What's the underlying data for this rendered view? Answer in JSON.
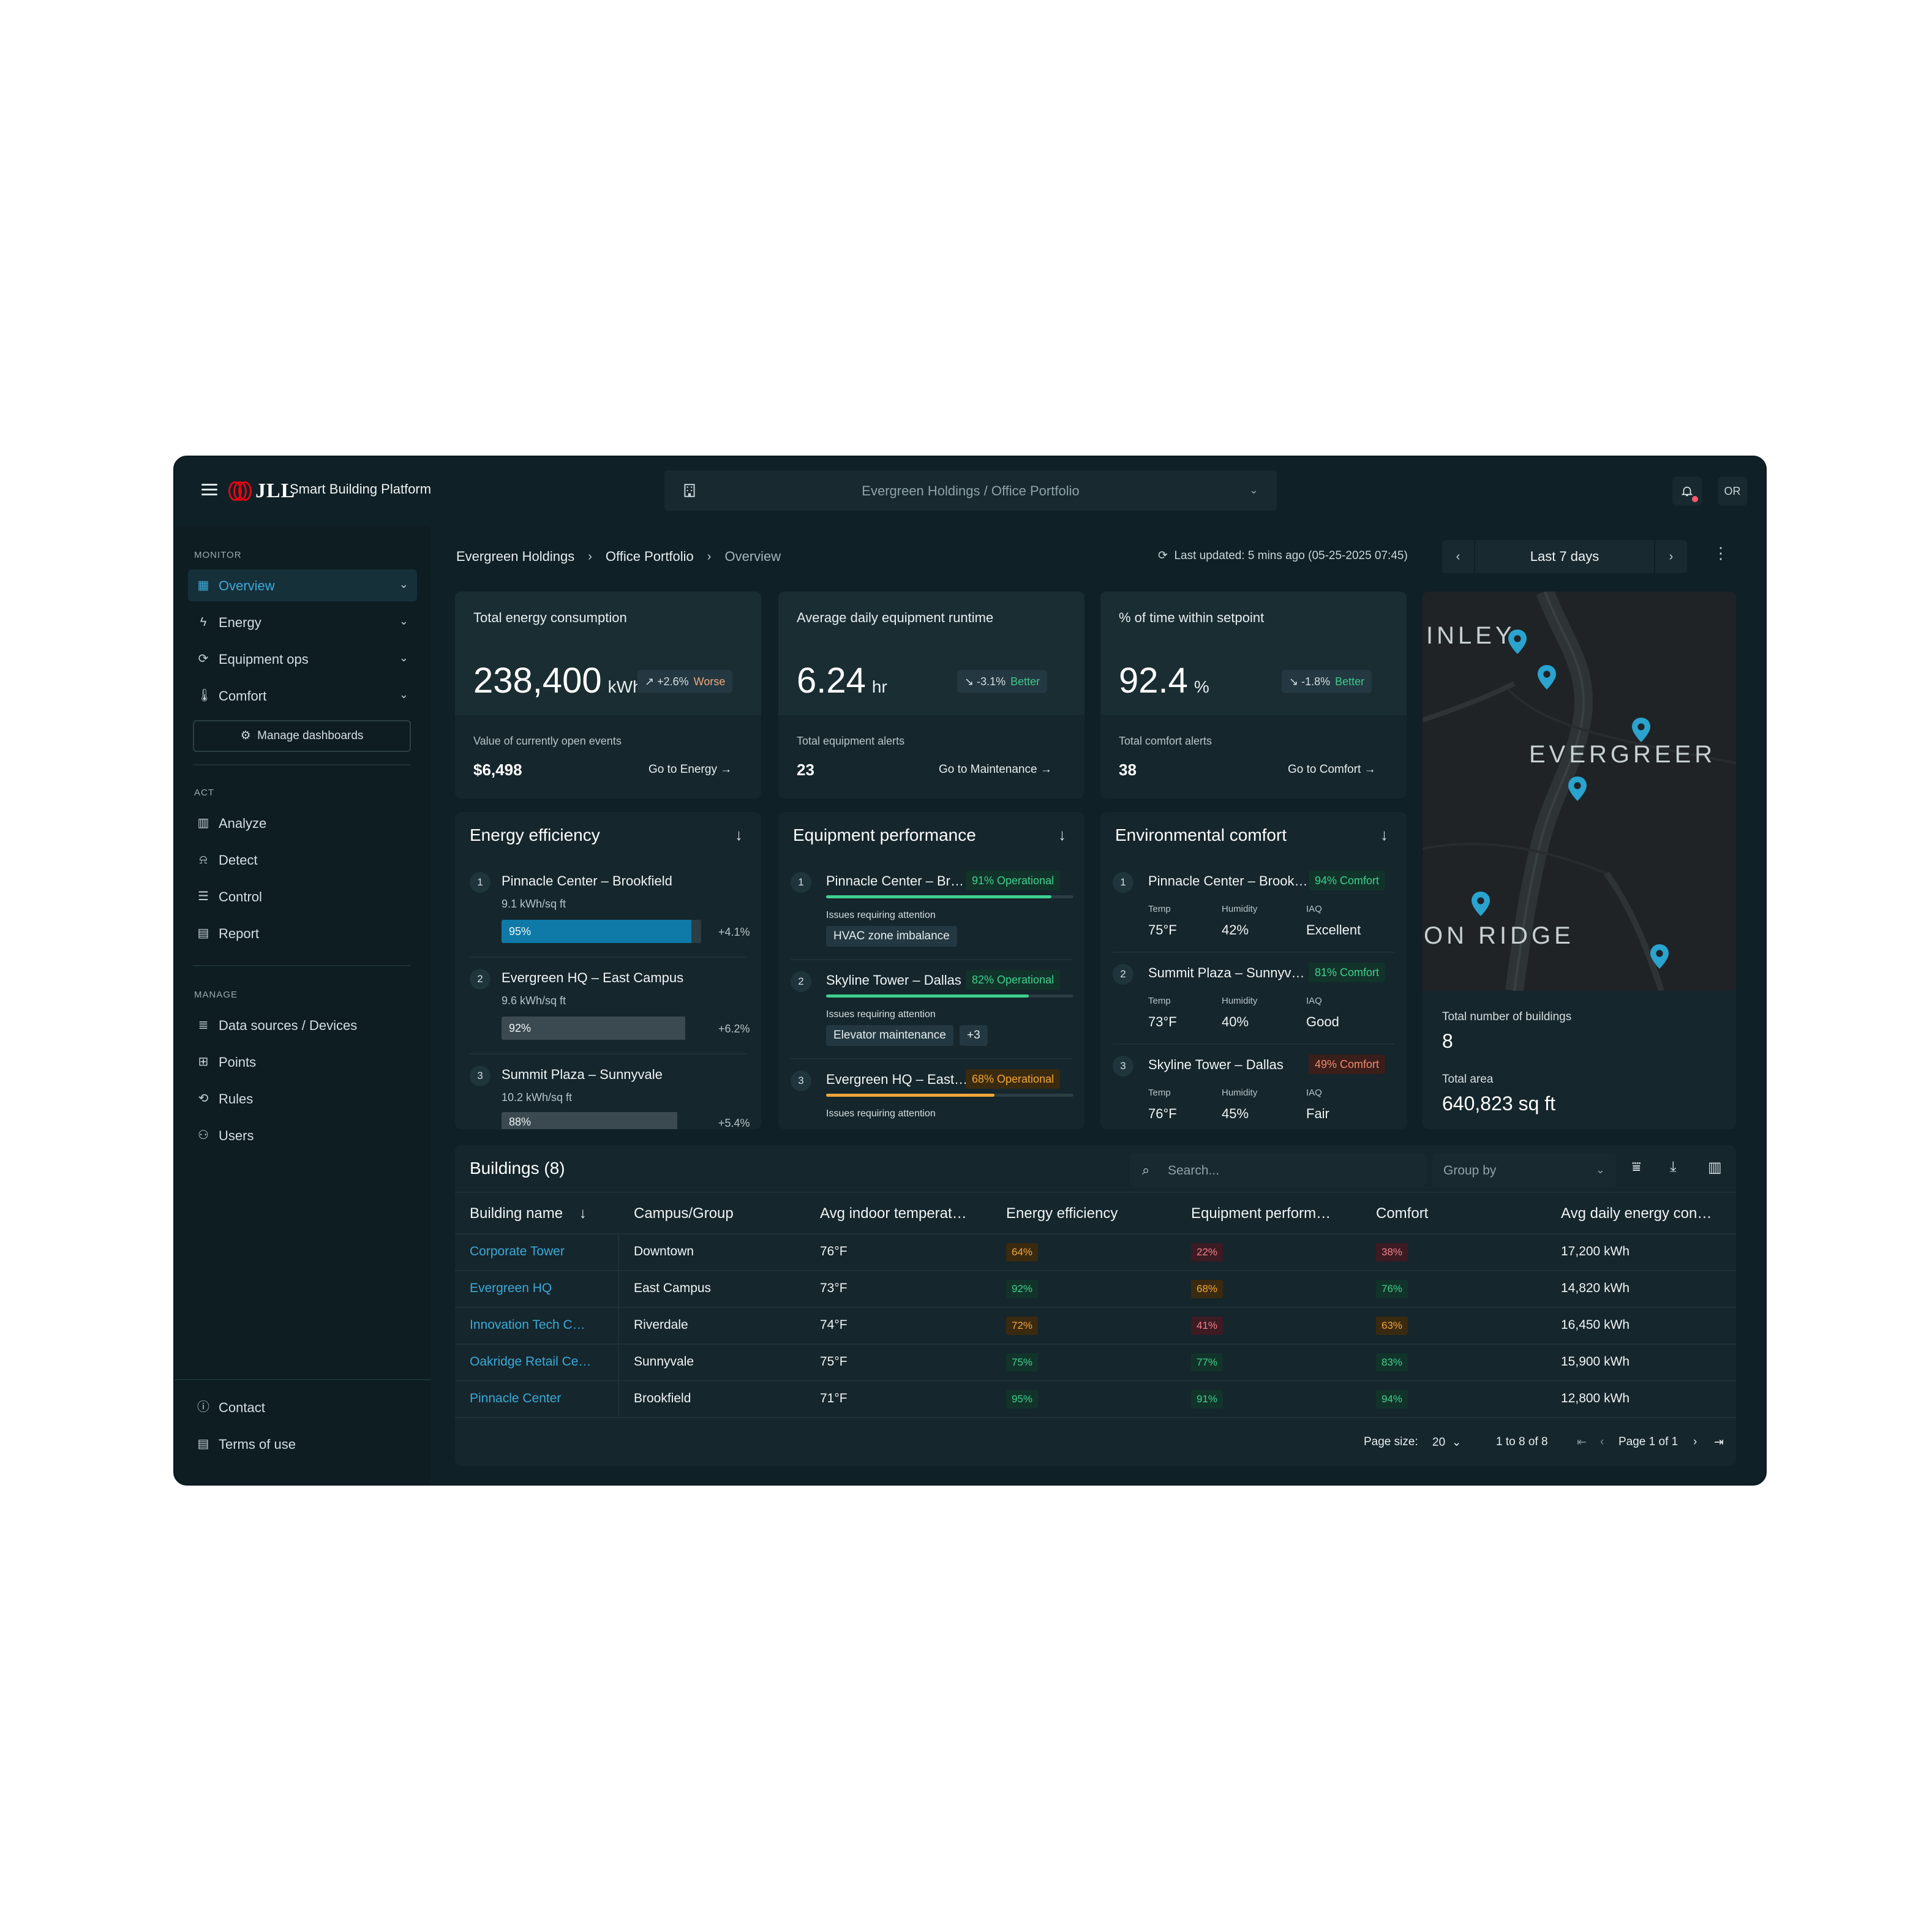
{
  "topbar": {
    "logo_text": "JLL",
    "app_title": "Smart Building Platform",
    "portfolio": "Evergreen Holdings / Office Portfolio",
    "avatar_initials": "OR"
  },
  "sidebar": {
    "sections": {
      "monitor": "MONITOR",
      "act": "ACT",
      "manage": "MANAGE"
    },
    "monitor_items": [
      {
        "label": "Overview",
        "icon": "overview-icon"
      },
      {
        "label": "Energy",
        "icon": "energy-icon"
      },
      {
        "label": "Equipment ops",
        "icon": "equipment-icon"
      },
      {
        "label": "Comfort",
        "icon": "comfort-icon"
      }
    ],
    "manage_dashboards": "Manage dashboards",
    "act_items": [
      {
        "label": "Analyze"
      },
      {
        "label": "Detect"
      },
      {
        "label": "Control"
      },
      {
        "label": "Report"
      }
    ],
    "manage_items": [
      {
        "label": "Data sources / Devices"
      },
      {
        "label": "Points"
      },
      {
        "label": "Rules"
      },
      {
        "label": "Users"
      }
    ],
    "footer_items": [
      {
        "label": "Contact"
      },
      {
        "label": "Terms of use"
      }
    ]
  },
  "header": {
    "breadcrumbs": [
      "Evergreen Holdings",
      "Office Portfolio",
      "Overview"
    ],
    "last_updated": "Last updated: 5 mins ago (05-25-2025 07:45)",
    "range": "Last 7 days"
  },
  "kpis": [
    {
      "title": "Total energy consumption",
      "value": "238,400",
      "unit": "kWh",
      "delta": "+2.6%",
      "trend": "Worse",
      "sub_label": "Value of currently open events",
      "sub_value": "$6,498",
      "link": "Go to Energy"
    },
    {
      "title": "Average daily equipment runtime",
      "value": "6.24",
      "unit": "hr",
      "delta": "-3.1%",
      "trend": "Better",
      "sub_label": "Total equipment alerts",
      "sub_value": "23",
      "link": "Go to Maintenance"
    },
    {
      "title": "% of time within setpoint",
      "value": "92.4",
      "unit": "%",
      "delta": "-1.8%",
      "trend": "Better",
      "sub_label": "Total comfort alerts",
      "sub_value": "38",
      "link": "Go to Comfort"
    }
  ],
  "energy_efficiency": {
    "title": "Energy efficiency",
    "rows": [
      {
        "rank": "1",
        "name": "Pinnacle Center – Brookfield",
        "sub": "9.1 kWh/sq ft",
        "pct": "95%",
        "value": 0.95,
        "delta": "+4.1%"
      },
      {
        "rank": "2",
        "name": "Evergreen HQ – East Campus",
        "sub": "9.6 kWh/sq ft",
        "pct": "92%",
        "value": 0.92,
        "delta": "+6.2%"
      },
      {
        "rank": "3",
        "name": "Summit Plaza – Sunnyvale",
        "sub": "10.2 kWh/sq ft",
        "pct": "88%",
        "value": 0.88,
        "delta": "+5.4%"
      }
    ]
  },
  "equipment_performance": {
    "title": "Equipment performance",
    "issue_label": "Issues requiring attention",
    "rows": [
      {
        "rank": "1",
        "name": "Pinnacle Center – Br…",
        "status": "91% Operational",
        "value": 0.91,
        "issues": [
          "HVAC zone imbalance"
        ],
        "more": ""
      },
      {
        "rank": "2",
        "name": "Skyline Tower – Dallas",
        "status": "82% Operational",
        "value": 0.82,
        "issues": [
          "Elevator maintenance"
        ],
        "more": "+3"
      },
      {
        "rank": "3",
        "name": "Evergreen HQ – East…",
        "status": "68% Operational",
        "value": 0.68,
        "issues": [],
        "more": ""
      }
    ]
  },
  "environmental_comfort": {
    "title": "Environmental comfort",
    "labels": {
      "temp": "Temp",
      "humidity": "Humidity",
      "iaq": "IAQ"
    },
    "rows": [
      {
        "rank": "1",
        "name": "Pinnacle Center – Brook…",
        "status": "94% Comfort",
        "temp": "75°F",
        "humidity": "42%",
        "iaq": "Excellent"
      },
      {
        "rank": "2",
        "name": "Summit Plaza – Sunnyv…",
        "status": "81% Comfort",
        "temp": "73°F",
        "humidity": "40%",
        "iaq": "Good"
      },
      {
        "rank": "3",
        "name": "Skyline Tower – Dallas",
        "status": "49% Comfort",
        "temp": "76°F",
        "humidity": "45%",
        "iaq": "Fair"
      }
    ]
  },
  "map": {
    "labels": [
      "INLEY",
      "EVERGREER",
      "ON RIDGE"
    ],
    "total_buildings_label": "Total number of buildings",
    "total_buildings": "8",
    "total_area_label": "Total area",
    "total_area": "640,823 sq ft"
  },
  "buildings": {
    "title": "Buildings (8)",
    "search_placeholder": "Search...",
    "group_by": "Group by",
    "columns": [
      "Building name",
      "Campus/Group",
      "Avg indoor temperat…",
      "Energy efficiency",
      "Equipment perform…",
      "Comfort",
      "Avg daily energy con…"
    ],
    "rows": [
      {
        "name": "Corporate Tower",
        "campus": "Downtown",
        "temp": "76°F",
        "eff": "64%",
        "equip": "22%",
        "comfort": "38%",
        "energy": "17,200 kWh"
      },
      {
        "name": "Evergreen HQ",
        "campus": "East Campus",
        "temp": "73°F",
        "eff": "92%",
        "equip": "68%",
        "comfort": "76%",
        "energy": "14,820 kWh"
      },
      {
        "name": "Innovation Tech C…",
        "campus": "Riverdale",
        "temp": "74°F",
        "eff": "72%",
        "equip": "41%",
        "comfort": "63%",
        "energy": "16,450 kWh"
      },
      {
        "name": "Oakridge Retail Ce…",
        "campus": "Sunnyvale",
        "temp": "75°F",
        "eff": "75%",
        "equip": "77%",
        "comfort": "83%",
        "energy": "15,900 kWh"
      },
      {
        "name": "Pinnacle Center",
        "campus": "Brookfield",
        "temp": "71°F",
        "eff": "95%",
        "equip": "91%",
        "comfort": "94%",
        "energy": "12,800 kWh"
      }
    ],
    "footer": {
      "page_size_label": "Page size:",
      "page_size": "20",
      "range": "1 to 8 of 8",
      "page": "Page 1 of 1"
    }
  },
  "colors": {
    "accent": "#3da9d8",
    "green": "#3fd08f",
    "orange": "#f2a63b",
    "red": "#f0808e",
    "worse": "#f0a77a"
  }
}
